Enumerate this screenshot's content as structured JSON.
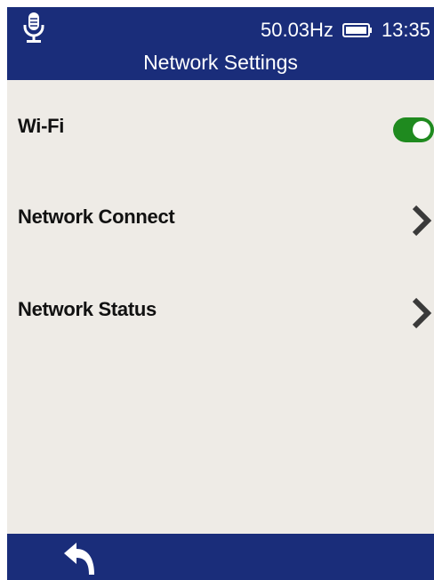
{
  "status_bar": {
    "frequency": "50.03Hz",
    "time": "13:35",
    "icons": [
      "microphone-icon",
      "battery-icon"
    ]
  },
  "header": {
    "title": "Network Settings"
  },
  "settings": {
    "items": [
      {
        "label": "Wi-Fi",
        "control": "toggle",
        "enabled": true
      },
      {
        "label": "Network Connect",
        "control": "chevron-right-icon"
      },
      {
        "label": "Network Status",
        "control": "chevron-right-icon"
      }
    ]
  },
  "footer": {
    "back_icon": "back-arrow-icon"
  },
  "colors": {
    "bar": "#1a2d7a",
    "background": "#eeebe6",
    "toggle_on": "#1f8a1f",
    "chevron": "#3a3a3a"
  }
}
